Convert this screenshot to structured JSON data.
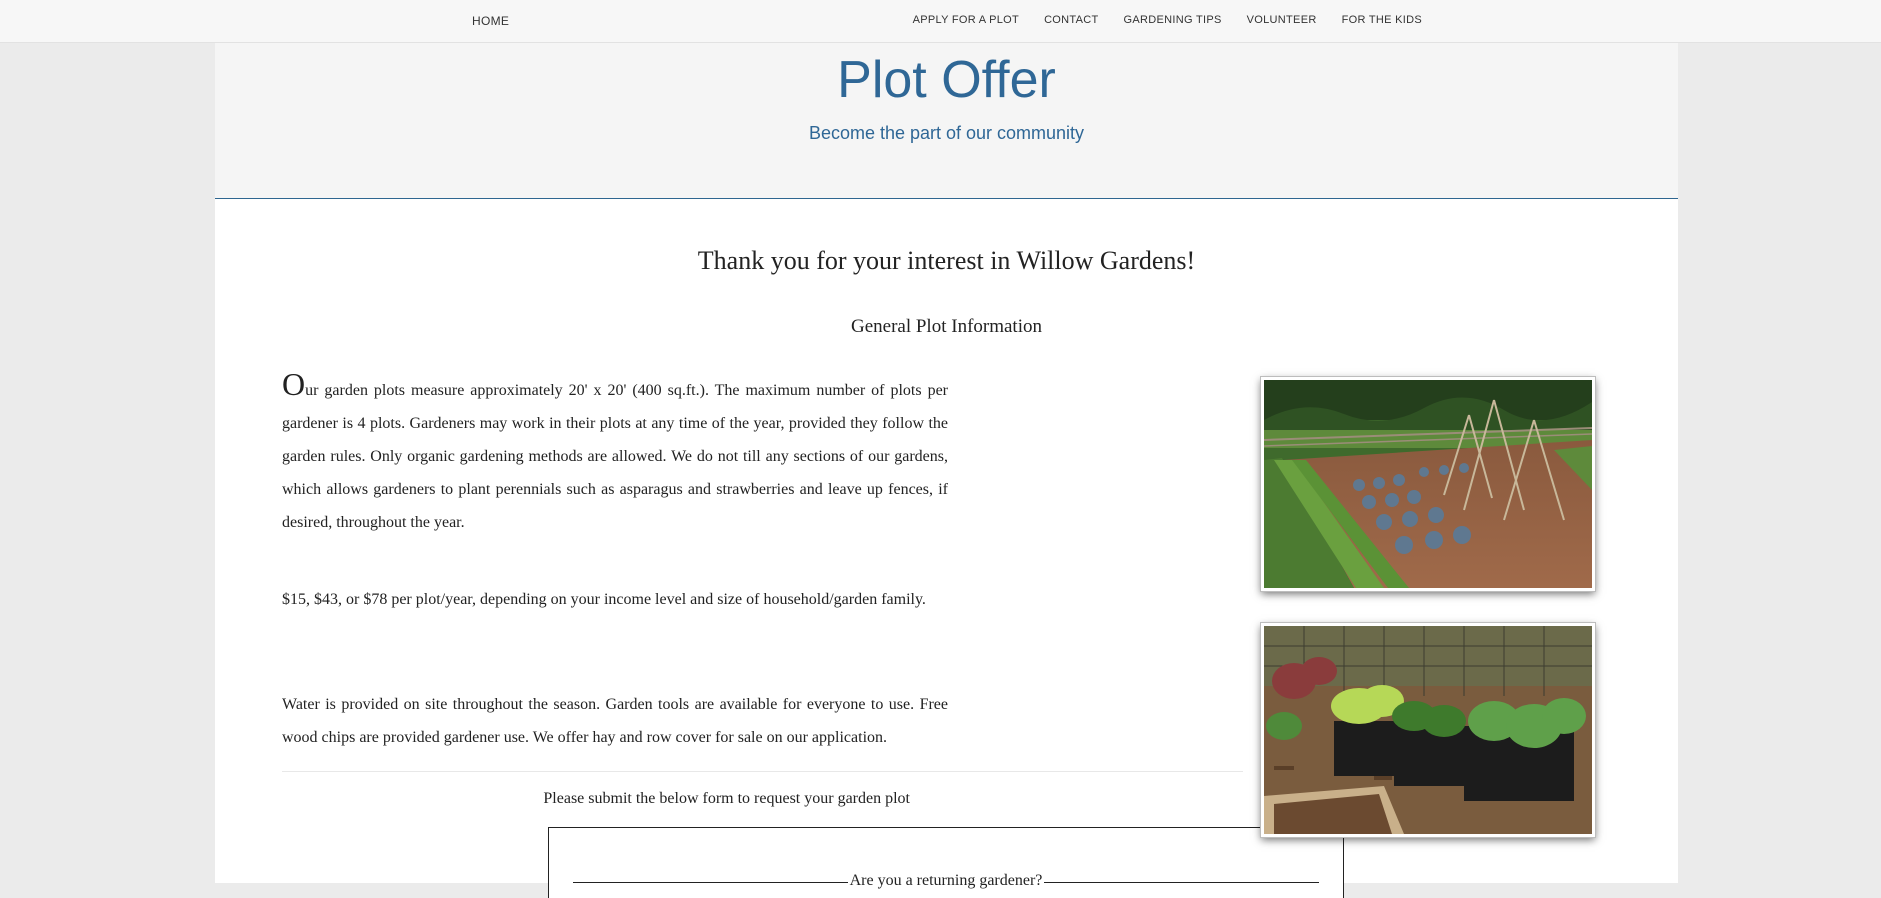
{
  "nav": {
    "home": "HOME",
    "links": [
      "APPLY FOR A PLOT",
      "CONTACT",
      "GARDENING TIPS",
      "VOLUNTEER",
      "FOR THE KIDS"
    ]
  },
  "hero": {
    "title": "Plot Offer",
    "subtitle": "Become the part of our community"
  },
  "content": {
    "thanks": "Thank you for your interest in Willow Gardens!",
    "section_heading": "General Plot Information",
    "p1_dropcap": "O",
    "p1_rest": "ur garden plots measure approximately 20' x 20' (400 sq.ft.). The maximum number of plots per gardener is 4 plots. Gardeners may work in their plots at any time of the year, provided they follow the garden rules. Only organic gardening methods are allowed. We do not till any sections of our gardens, which allows gardeners to plant perennials such as asparagus and strawberries and leave up fences, if desired, throughout the year.",
    "p2": "$15, $43, or $78 per plot/year, depending on your income level and size of household/garden family.",
    "p3": "Water is provided on site throughout the season. Garden tools are available for everyone to use. Free wood chips are provided gardener use. We offer hay and row cover for sale on our application.",
    "form_prompt": "Please submit the below form to request your garden plot"
  },
  "form": {
    "legend": "Are you a returning gardener?"
  },
  "colors": {
    "accent": "#2f6796",
    "page_bg": "#ebebeb",
    "nav_bg": "#f7f7f7"
  },
  "images": [
    {
      "name": "garden-plot-photo",
      "depicts": "tilled garden plot with rows of greens, cabbages and bean teepees"
    },
    {
      "name": "seedlings-photo",
      "depicts": "trays of lettuce and vegetable seedlings by a raised bed"
    }
  ]
}
